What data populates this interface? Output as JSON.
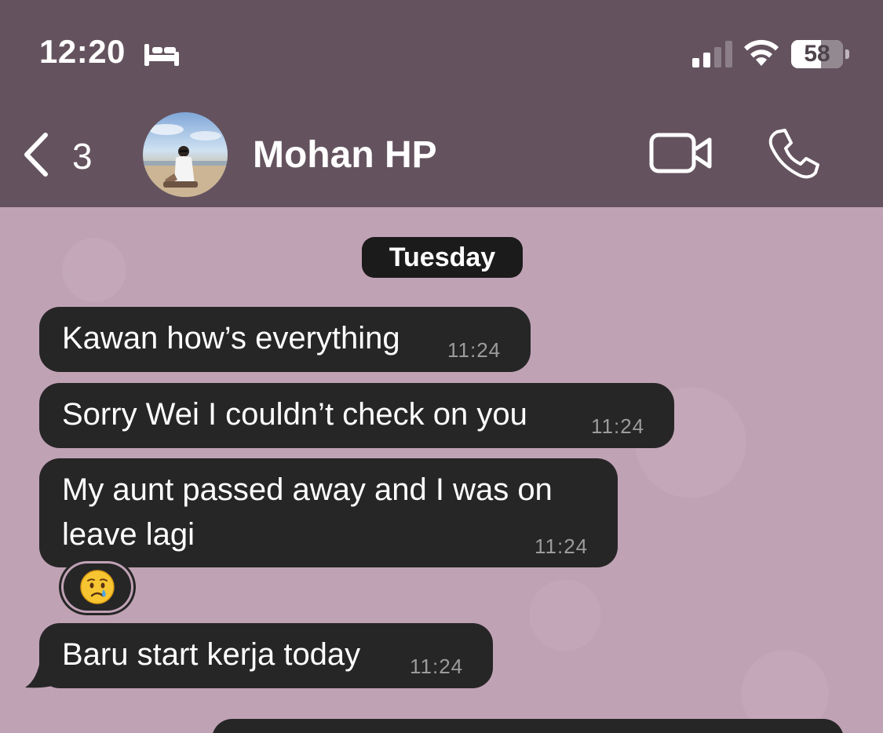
{
  "status_bar": {
    "time": "12:20",
    "focus_icon": "bed-icon",
    "battery_level": "58",
    "battery_fraction": 0.58
  },
  "header": {
    "back_count": "3",
    "contact_name": "Mohan HP",
    "icons": {
      "back": "chevron-left-icon",
      "video": "video-camera-icon",
      "call": "phone-icon"
    }
  },
  "chat": {
    "date_label": "Tuesday",
    "messages": [
      {
        "lines": [
          "Kawan how’s everything"
        ],
        "time": "11:24"
      },
      {
        "lines": [
          "Sorry Wei I couldn’t check on you"
        ],
        "time": "11:24"
      },
      {
        "lines": [
          "My aunt passed away and I was on",
          "leave lagi"
        ],
        "time": "11:24",
        "reaction": "crying-face-emoji"
      },
      {
        "lines": [
          "Baru start kerja today"
        ],
        "time": "11:24"
      }
    ]
  },
  "colors": {
    "header_bg": "#64535f",
    "chat_bg": "#c0a2b5",
    "bubble_bg": "#262626",
    "date_pill_bg": "#1b1b1b"
  }
}
